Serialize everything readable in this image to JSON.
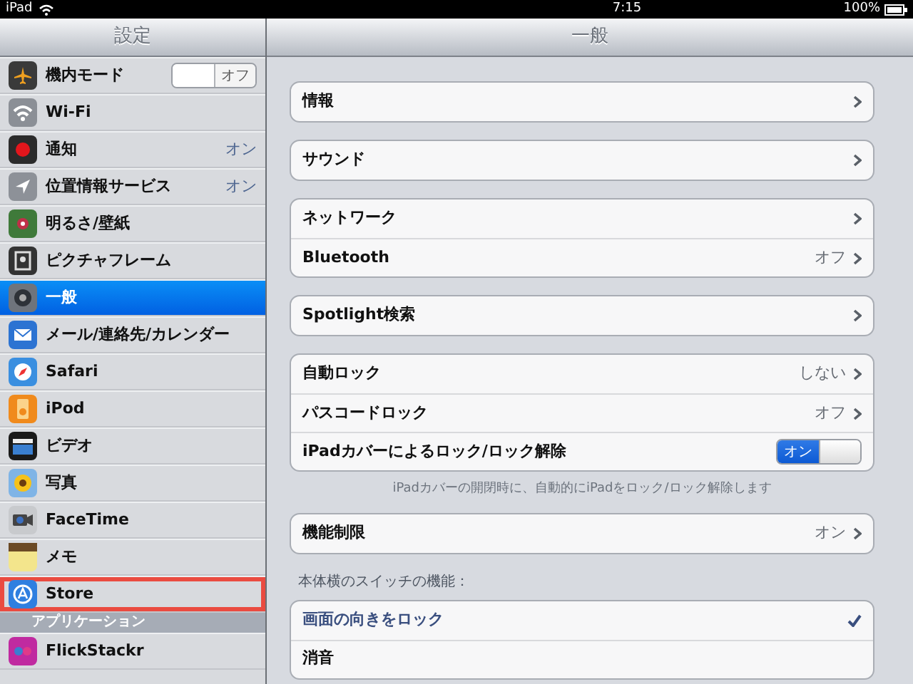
{
  "status_bar": {
    "device": "iPad",
    "time": "7:15",
    "battery": "100%"
  },
  "sidebar": {
    "title": "設定",
    "items": [
      {
        "label": "機内モード",
        "kind": "toggle",
        "value": "オフ",
        "on": false,
        "selected": false,
        "highlighted": false
      },
      {
        "label": "Wi-Fi",
        "kind": "plain",
        "selected": false,
        "highlighted": false
      },
      {
        "label": "通知",
        "kind": "value",
        "value": "オン",
        "selected": false,
        "highlighted": false
      },
      {
        "label": "位置情報サービス",
        "kind": "value",
        "value": "オン",
        "selected": false,
        "highlighted": false
      },
      {
        "label": "明るさ/壁紙",
        "kind": "plain",
        "selected": false,
        "highlighted": false
      },
      {
        "label": "ピクチャフレーム",
        "kind": "plain",
        "selected": false,
        "highlighted": false
      },
      {
        "label": "一般",
        "kind": "plain",
        "selected": true,
        "highlighted": false
      },
      {
        "label": "メール/連絡先/カレンダー",
        "kind": "plain",
        "selected": false,
        "highlighted": false
      },
      {
        "label": "Safari",
        "kind": "plain",
        "selected": false,
        "highlighted": false
      },
      {
        "label": "iPod",
        "kind": "plain",
        "selected": false,
        "highlighted": false
      },
      {
        "label": "ビデオ",
        "kind": "plain",
        "selected": false,
        "highlighted": false
      },
      {
        "label": "写真",
        "kind": "plain",
        "selected": false,
        "highlighted": false
      },
      {
        "label": "FaceTime",
        "kind": "plain",
        "selected": false,
        "highlighted": false
      },
      {
        "label": "メモ",
        "kind": "plain",
        "selected": false,
        "highlighted": false
      },
      {
        "label": "Store",
        "kind": "plain",
        "selected": false,
        "highlighted": true
      }
    ],
    "section_header": "アプリケーション",
    "apps": [
      {
        "label": "FlickStackr",
        "selected": false,
        "highlighted": false
      }
    ]
  },
  "detail": {
    "title": "一般",
    "groups": [
      {
        "rows": [
          {
            "label": "情報",
            "kind": "link"
          }
        ]
      },
      {
        "rows": [
          {
            "label": "サウンド",
            "kind": "link"
          }
        ]
      },
      {
        "rows": [
          {
            "label": "ネットワーク",
            "kind": "link"
          },
          {
            "label": "Bluetooth",
            "kind": "link",
            "value": "オフ"
          }
        ]
      },
      {
        "rows": [
          {
            "label": "Spotlight検索",
            "kind": "link"
          }
        ]
      },
      {
        "rows": [
          {
            "label": "自動ロック",
            "kind": "link",
            "value": "しない"
          },
          {
            "label": "パスコードロック",
            "kind": "link",
            "value": "オフ"
          },
          {
            "label": "iPadカバーによるロック/ロック解除",
            "kind": "toggle",
            "value": "オン",
            "on": true
          }
        ],
        "footer": "iPadカバーの開閉時に、自動的にiPadをロック/ロック解除します"
      },
      {
        "rows": [
          {
            "label": "機能制限",
            "kind": "link",
            "value": "オン"
          }
        ]
      },
      {
        "header": "本体横のスイッチの機能：",
        "rows": [
          {
            "label": "画面の向きをロック",
            "kind": "check",
            "checked": true
          },
          {
            "label": "消音",
            "kind": "check",
            "checked": false
          }
        ]
      }
    ]
  }
}
